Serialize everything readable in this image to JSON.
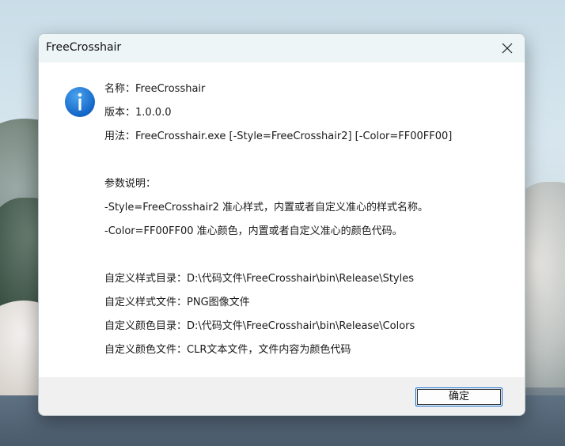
{
  "dialog": {
    "title": "FreeCrosshair",
    "close_icon": "close-icon",
    "info_icon": "info-icon",
    "accent_color": "#1a73d6",
    "lines": [
      "名称：FreeCrosshair",
      "版本：1.0.0.0",
      "用法：FreeCrosshair.exe [-Style=FreeCrosshair2] [-Color=FF00FF00]",
      "",
      "参数说明：",
      "-Style=FreeCrosshair2    准心样式，内置或者自定义准心的样式名称。",
      "-Color=FF00FF00    准心颜色，内置或者自定义准心的颜色代码。",
      "",
      "自定义样式目录：D:\\代码文件\\FreeCrosshair\\bin\\Release\\Styles",
      "自定义样式文件：PNG图像文件",
      "自定义颜色目录：D:\\代码文件\\FreeCrosshair\\bin\\Release\\Colors",
      "自定义颜色文件：CLR文本文件，文件内容为颜色代码"
    ],
    "ok_label": "确定"
  }
}
